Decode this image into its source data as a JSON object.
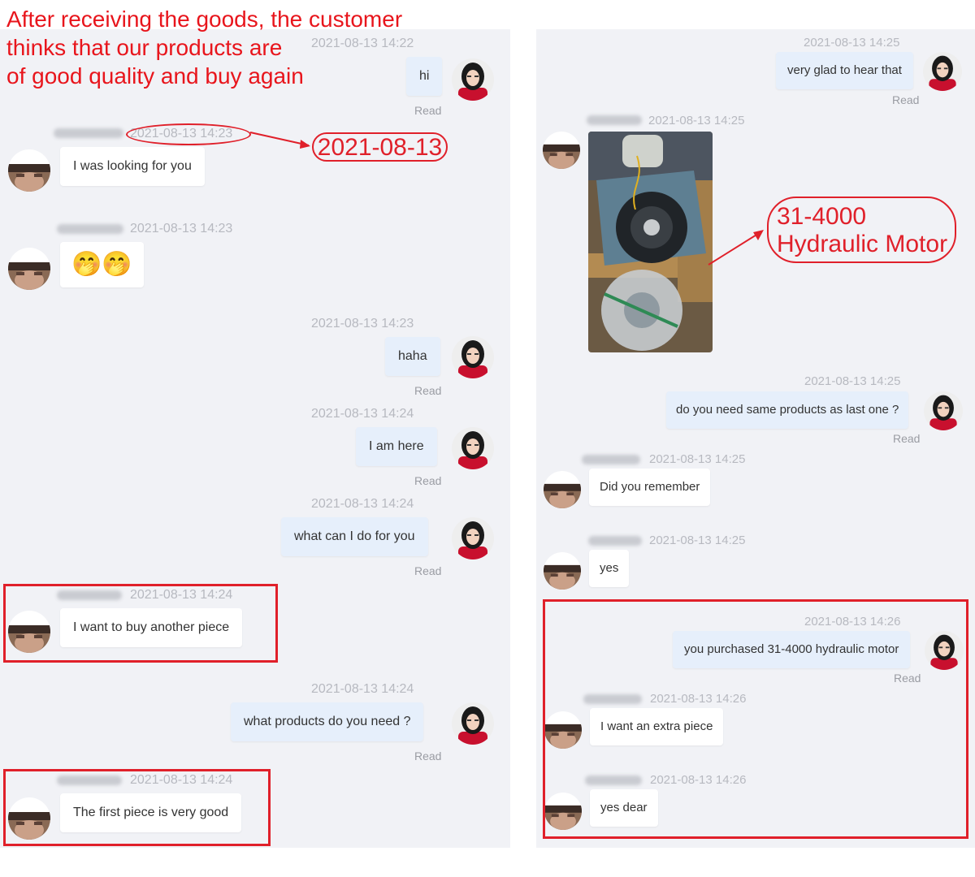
{
  "annotation": {
    "headline_lines": [
      "After receiving the goods, the customer",
      "thinks that our products are",
      "of good quality and buy again"
    ],
    "date_callout": "2021-08-13",
    "product_callout_lines": [
      "31-4000",
      "Hydraulic Motor"
    ]
  },
  "left_chat": [
    {
      "dir": "out",
      "time": "2021-08-13 14:22",
      "text": "hi",
      "status": "Read"
    },
    {
      "dir": "in",
      "time": "2021-08-13 14:23",
      "text": "I was looking for you"
    },
    {
      "dir": "in",
      "time": "2021-08-13 14:23",
      "text": "🤭🤭"
    },
    {
      "dir": "out",
      "time": "2021-08-13 14:23",
      "text": "haha",
      "status": "Read"
    },
    {
      "dir": "out",
      "time": "2021-08-13 14:24",
      "text": "I am here",
      "status": "Read"
    },
    {
      "dir": "out",
      "time": "2021-08-13 14:24",
      "text": "what can I do for you",
      "status": "Read"
    },
    {
      "dir": "in",
      "time": "2021-08-13 14:24",
      "text": "I want to buy another piece"
    },
    {
      "dir": "out",
      "time": "2021-08-13 14:24",
      "text": "what products do you need ?",
      "status": "Read"
    },
    {
      "dir": "in",
      "time": "2021-08-13 14:24",
      "text": "The first piece is very good"
    }
  ],
  "right_chat": [
    {
      "dir": "out",
      "time": "2021-08-13 14:25",
      "text": "very glad to hear that",
      "status": "Read"
    },
    {
      "dir": "in",
      "time": "2021-08-13 14:25",
      "text": "",
      "image": "hydraulic-motor-photo"
    },
    {
      "dir": "out",
      "time": "2021-08-13 14:25",
      "text": "do you need same products as last one ?",
      "status": "Read"
    },
    {
      "dir": "in",
      "time": "2021-08-13 14:25",
      "text": "Did you remember"
    },
    {
      "dir": "in",
      "time": "2021-08-13 14:25",
      "text": "yes"
    },
    {
      "dir": "out",
      "time": "2021-08-13 14:26",
      "text": "you purchased 31-4000 hydraulic motor",
      "status": "Read"
    },
    {
      "dir": "in",
      "time": "2021-08-13 14:26",
      "text": "I want an extra piece"
    },
    {
      "dir": "in",
      "time": "2021-08-13 14:26",
      "text": "yes dear"
    }
  ],
  "colors": {
    "annotation_red": "#e0202a",
    "panel_bg": "#f1f2f6",
    "outgoing_bubble": "#e6effb",
    "incoming_bubble": "#ffffff"
  }
}
